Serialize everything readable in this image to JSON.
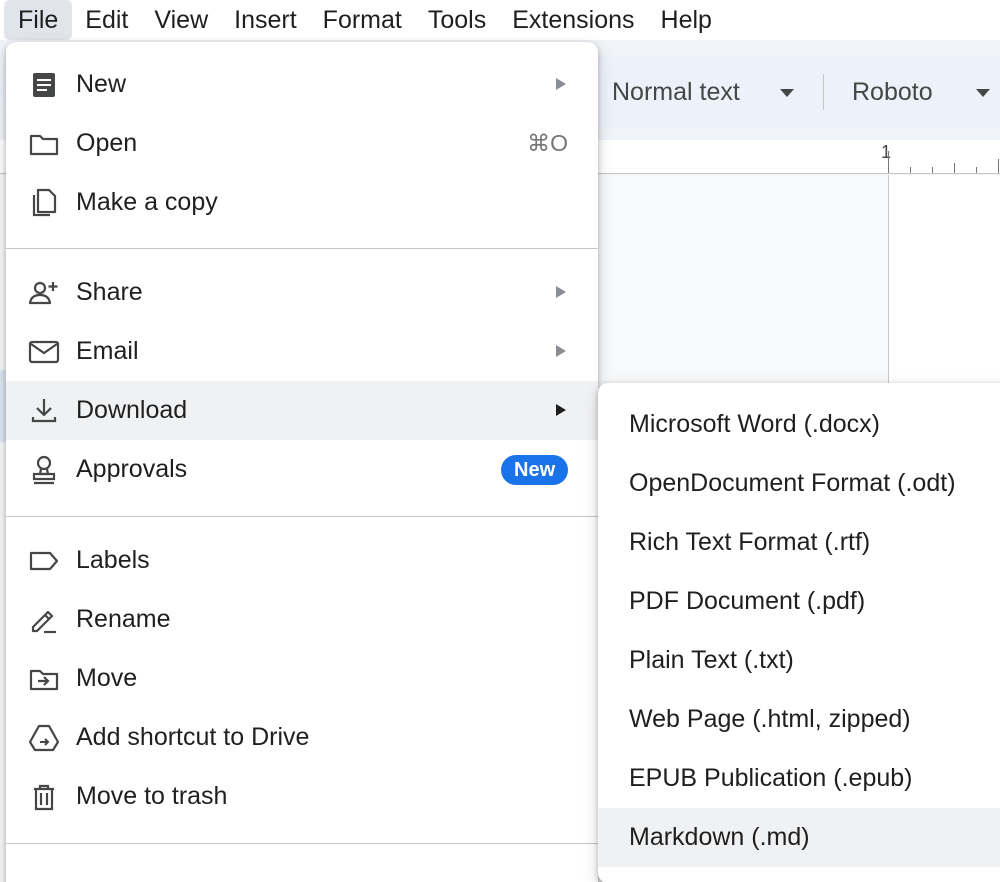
{
  "menubar": {
    "items": [
      "File",
      "Edit",
      "View",
      "Insert",
      "Format",
      "Tools",
      "Extensions",
      "Help"
    ]
  },
  "toolbar": {
    "style_value": "Normal text",
    "font_value": "Roboto"
  },
  "ruler": {
    "label": "1"
  },
  "file_menu": {
    "new": {
      "label": "New",
      "icon": "document-icon"
    },
    "open": {
      "label": "Open",
      "shortcut": "⌘O",
      "icon": "folder-icon"
    },
    "make_copy": {
      "label": "Make a copy",
      "icon": "copy-icon"
    },
    "share": {
      "label": "Share",
      "icon": "person-add-icon"
    },
    "email": {
      "label": "Email",
      "icon": "mail-icon"
    },
    "download": {
      "label": "Download",
      "icon": "download-icon"
    },
    "approvals": {
      "label": "Approvals",
      "badge": "New",
      "icon": "stamp-icon"
    },
    "labels": {
      "label": "Labels",
      "icon": "label-icon"
    },
    "rename": {
      "label": "Rename",
      "icon": "pencil-icon"
    },
    "move": {
      "label": "Move",
      "icon": "folder-move-icon"
    },
    "add_shortcut": {
      "label": "Add shortcut to Drive",
      "icon": "drive-shortcut-icon"
    },
    "trash": {
      "label": "Move to trash",
      "icon": "trash-icon"
    }
  },
  "download_submenu": {
    "items": [
      "Microsoft Word (.docx)",
      "OpenDocument Format (.odt)",
      "Rich Text Format (.rtf)",
      "PDF Document (.pdf)",
      "Plain Text (.txt)",
      "Web Page (.html, zipped)",
      "EPUB Publication (.epub)",
      "Markdown (.md)"
    ],
    "highlighted": "Markdown (.md)"
  },
  "colors": {
    "accent": "#1a73e8",
    "toolbar_bg": "#edf2fa",
    "hover_bg": "#f0f1f3"
  }
}
